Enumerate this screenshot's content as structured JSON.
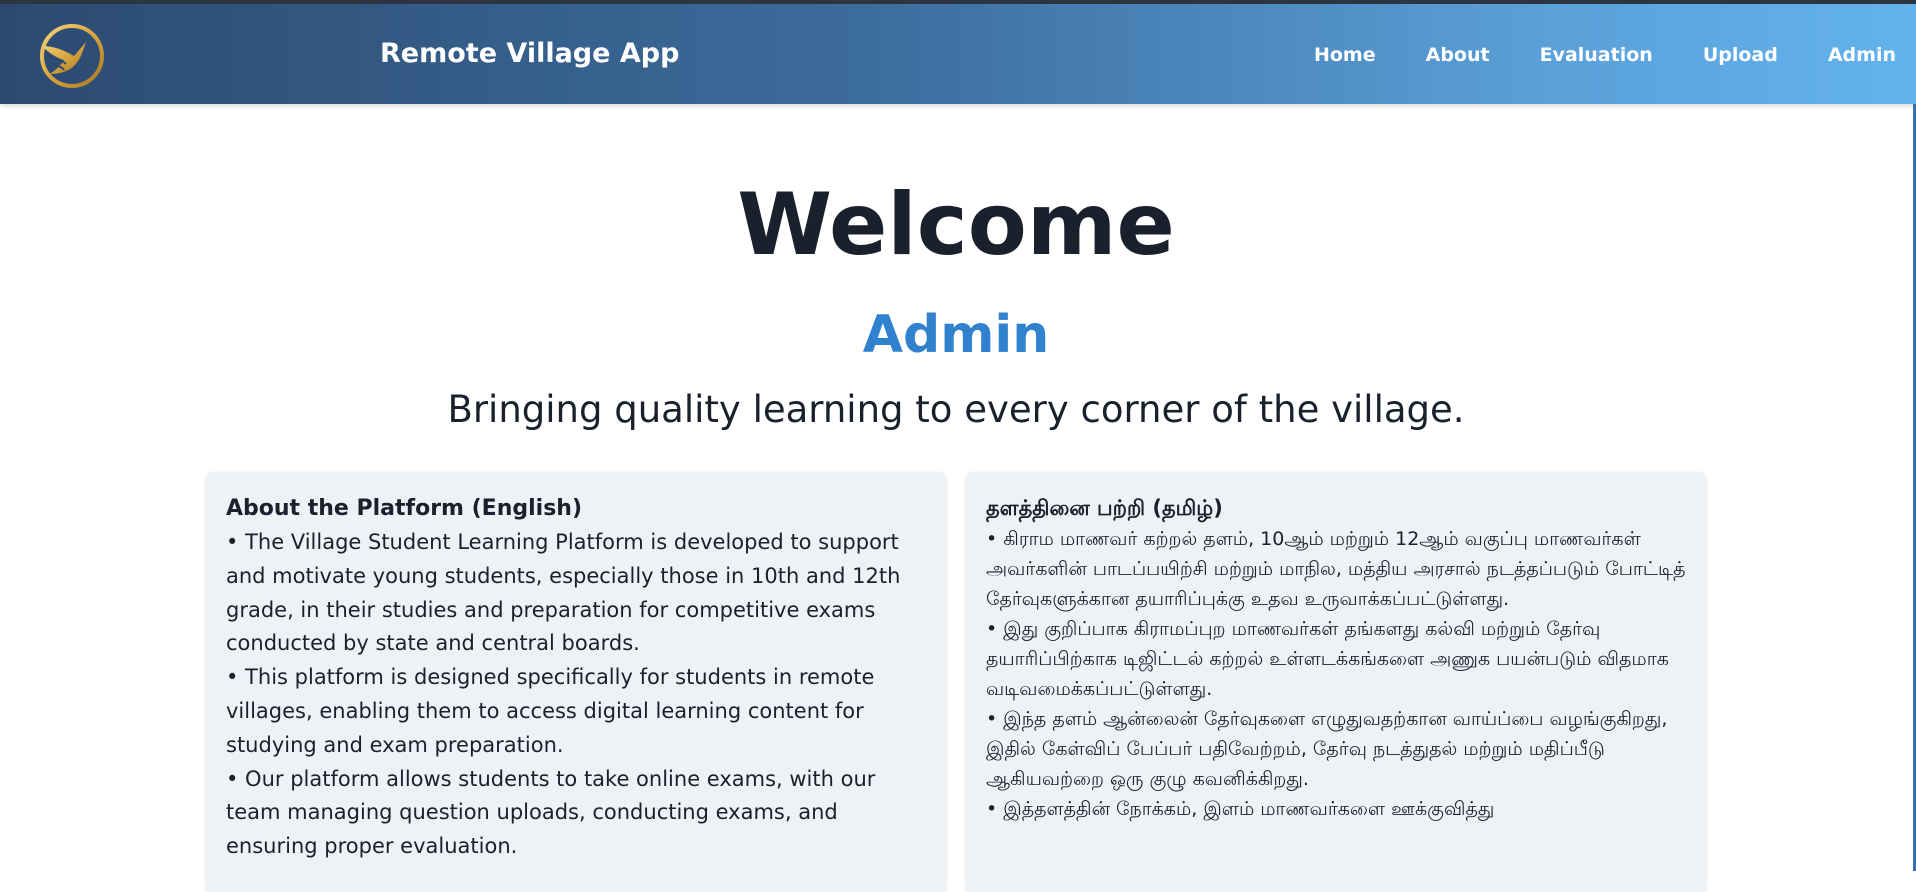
{
  "header": {
    "logo_icon": "golden-bird-logo-icon",
    "app_title": "Remote Village App",
    "nav": [
      {
        "label": "Home"
      },
      {
        "label": "About"
      },
      {
        "label": "Evaluation"
      },
      {
        "label": "Upload"
      },
      {
        "label": "Admin"
      }
    ],
    "gradient_colors": [
      "#2c4a70",
      "#63b3ed"
    ]
  },
  "hero": {
    "welcome": "Welcome",
    "user_name": "Admin",
    "tagline": "Bringing quality learning to every corner of the village."
  },
  "about_english": {
    "title": "About the Platform (English)",
    "paragraphs": [
      "• The Village Student Learning Platform is developed to support and motivate young students, especially those in 10th and 12th grade, in their studies and preparation for competitive exams conducted by state and central boards.",
      "• This platform is designed specifically for students in remote villages, enabling them to access digital learning content for studying and exam preparation.",
      "• Our platform allows students to take online exams, with our team managing question uploads, conducting exams, and ensuring proper evaluation."
    ]
  },
  "about_tamil": {
    "title": "தளத்தினை பற்றி (தமிழ்)",
    "paragraphs": [
      "• கிராம மாணவர் கற்றல் தளம், 10ஆம் மற்றும் 12ஆம் வகுப்பு மாணவர்கள் அவர்களின் பாடப்பயிற்சி மற்றும் மாநில, மத்திய அரசால் நடத்தப்படும் போட்டித் தேர்வுகளுக்கான தயாரிப்புக்கு உதவ உருவாக்கப்பட்டுள்ளது.",
      "• இது குறிப்பாக கிராமப்புற மாணவர்கள் தங்களது கல்வி மற்றும் தேர்வு தயாரிப்பிற்காக டிஜிட்டல் கற்றல் உள்ளடக்கங்களை அணுக பயன்படும் விதமாக வடிவமைக்கப்பட்டுள்ளது.",
      "• இந்த தளம் ஆன்லைன் தேர்வுகளை எழுதுவதற்கான வாய்ப்பை வழங்குகிறது, இதில் கேள்விப் பேப்பர் பதிவேற்றம், தேர்வு நடத்துதல் மற்றும் மதிப்பீடு ஆகியவற்றை ஒரு குழு கவனிக்கிறது.",
      "• இத்தளத்தின் நோக்கம், இளம் மாணவர்களை ஊக்குவித்து"
    ]
  },
  "colors": {
    "accent": "#3182ce",
    "card_bg": "#edf2f7",
    "text": "#1a202c"
  }
}
